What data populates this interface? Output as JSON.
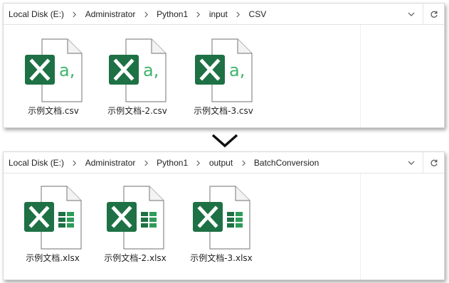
{
  "top_window": {
    "breadcrumbs": [
      "Local Disk (E:)",
      "Administrator",
      "Python1",
      "input",
      "CSV"
    ],
    "files": [
      {
        "name": "示例文档.csv",
        "icon": "csv-file-icon"
      },
      {
        "name": "示例文档-2.csv",
        "icon": "csv-file-icon"
      },
      {
        "name": "示例文档-3.csv",
        "icon": "csv-file-icon"
      }
    ]
  },
  "bottom_window": {
    "breadcrumbs": [
      "Local Disk (E:)",
      "Administrator",
      "Python1",
      "output",
      "BatchConversion"
    ],
    "files": [
      {
        "name": "示例文档.xlsx",
        "icon": "xlsx-file-icon"
      },
      {
        "name": "示例文档-2.xlsx",
        "icon": "xlsx-file-icon"
      },
      {
        "name": "示例文档-3.xlsx",
        "icon": "xlsx-file-icon"
      }
    ]
  },
  "icons": {
    "address_dropdown": "chevron-down-icon",
    "refresh": "refresh-icon",
    "conversion_arrow": "chevron-down-icon"
  },
  "colors": {
    "excel_green": "#1e7145",
    "csv_accent": "#3fb36b"
  }
}
